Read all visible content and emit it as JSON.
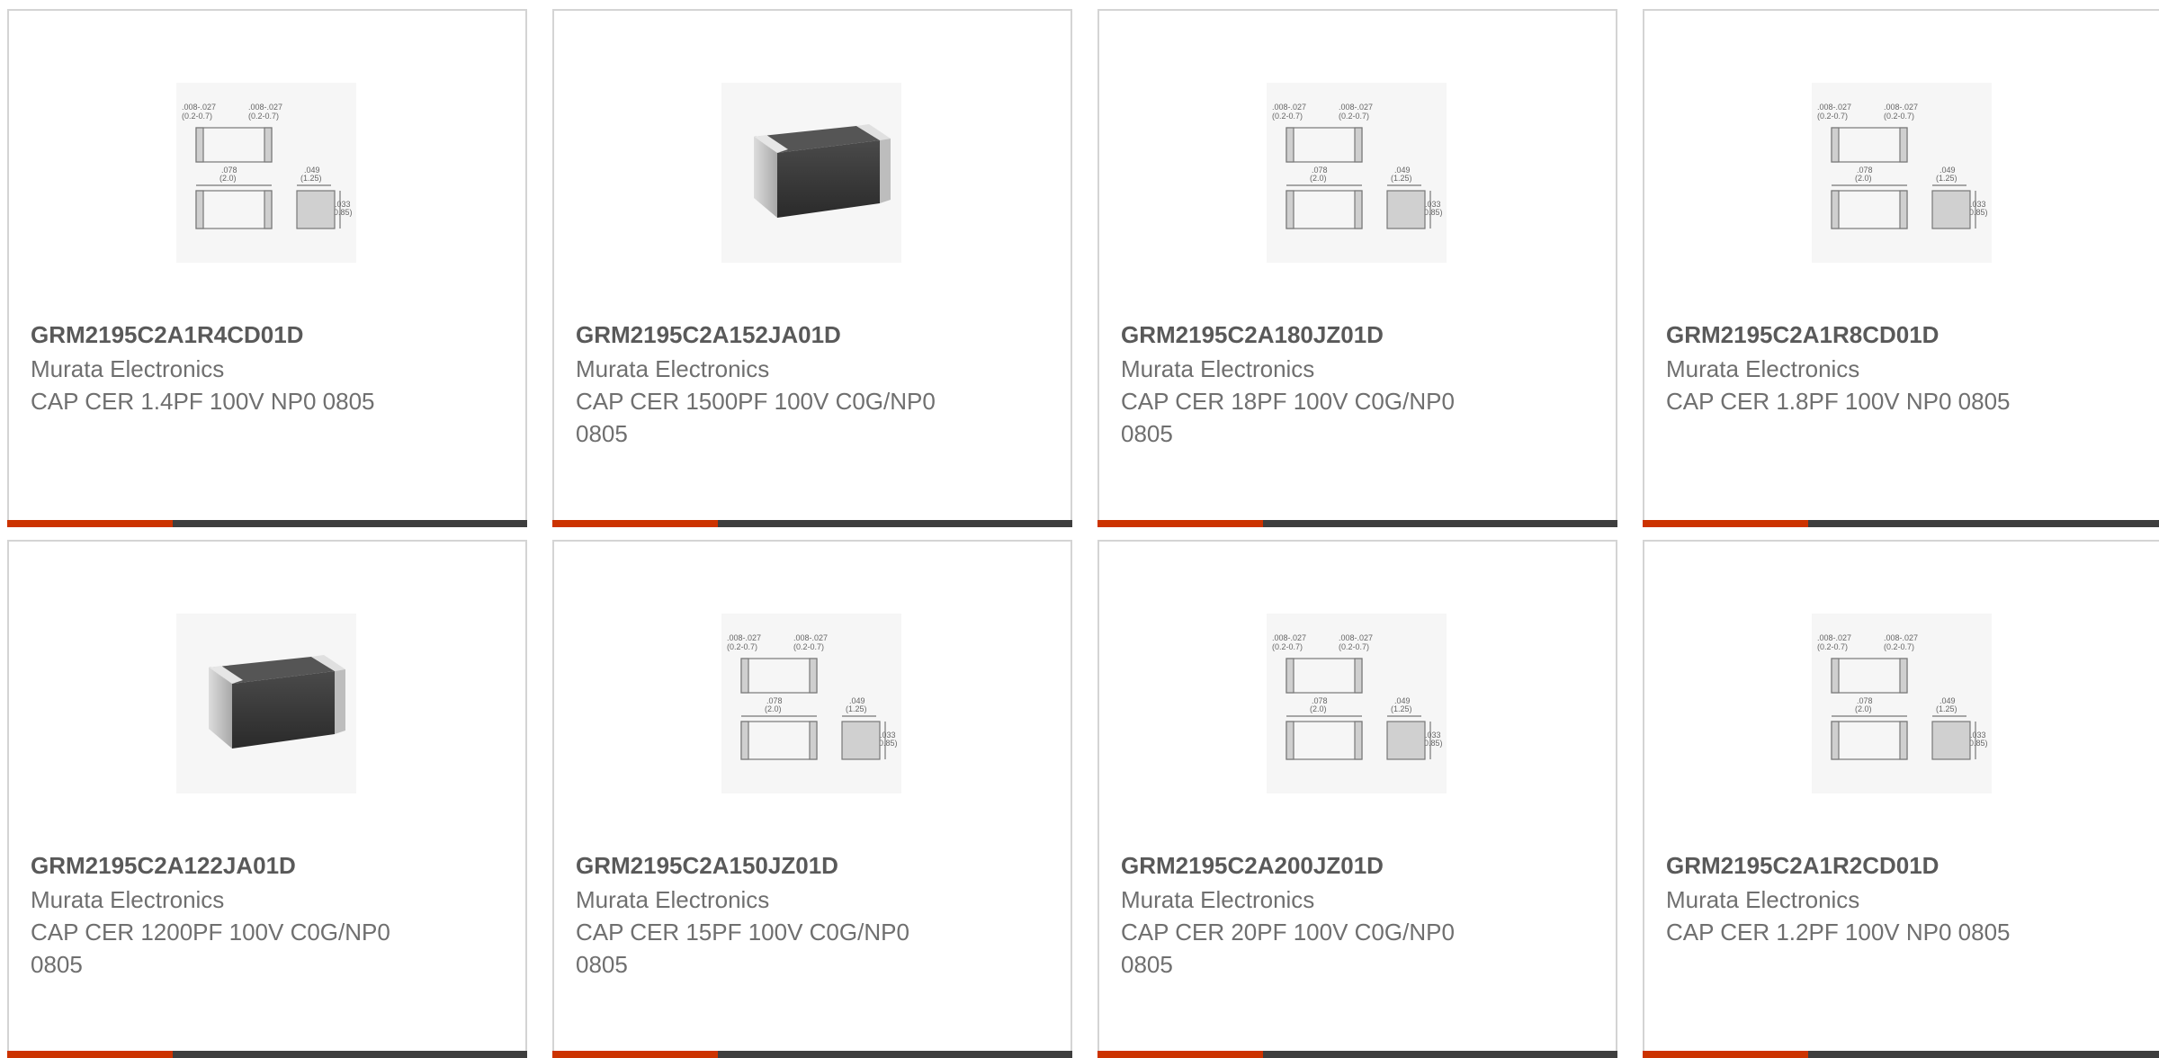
{
  "products": [
    {
      "part_number": "GRM2195C2A1R4CD01D",
      "manufacturer": "Murata Electronics",
      "description": "CAP CER 1.4PF 100V NP0 0805",
      "image": "dimension-drawing"
    },
    {
      "part_number": "GRM2195C2A152JA01D",
      "manufacturer": "Murata Electronics",
      "description": "CAP CER 1500PF 100V C0G/NP0 0805",
      "image": "capacitor-photo"
    },
    {
      "part_number": "GRM2195C2A180JZ01D",
      "manufacturer": "Murata Electronics",
      "description": "CAP CER 18PF 100V C0G/NP0 0805",
      "image": "dimension-drawing"
    },
    {
      "part_number": "GRM2195C2A1R8CD01D",
      "manufacturer": "Murata Electronics",
      "description": "CAP CER 1.8PF 100V NP0 0805",
      "image": "dimension-drawing"
    },
    {
      "part_number": "GRM2195C2A122JA01D",
      "manufacturer": "Murata Electronics",
      "description": "CAP CER 1200PF 100V C0G/NP0 0805",
      "image": "capacitor-photo"
    },
    {
      "part_number": "GRM2195C2A150JZ01D",
      "manufacturer": "Murata Electronics",
      "description": "CAP CER 15PF 100V C0G/NP0 0805",
      "image": "dimension-drawing"
    },
    {
      "part_number": "GRM2195C2A200JZ01D",
      "manufacturer": "Murata Electronics",
      "description": "CAP CER 20PF 100V C0G/NP0 0805",
      "image": "dimension-drawing"
    },
    {
      "part_number": "GRM2195C2A1R2CD01D",
      "manufacturer": "Murata Electronics",
      "description": "CAP CER 1.2PF 100V NP0 0805",
      "image": "dimension-drawing"
    }
  ],
  "drawing_labels": {
    "top_left": ".008-.027",
    "top_left_mm": "(0.2-0.7)",
    "top_right": ".008-.027",
    "top_right_mm": "(0.2-0.7)",
    "length": ".078",
    "length_mm": "(2.0)",
    "width": ".049",
    "width_mm": "(1.25)",
    "height": ".033",
    "height_mm": "(0.85)"
  },
  "colors": {
    "accent": "#cc3300",
    "bar": "#3e3e3e",
    "border": "#d4d4d4"
  }
}
